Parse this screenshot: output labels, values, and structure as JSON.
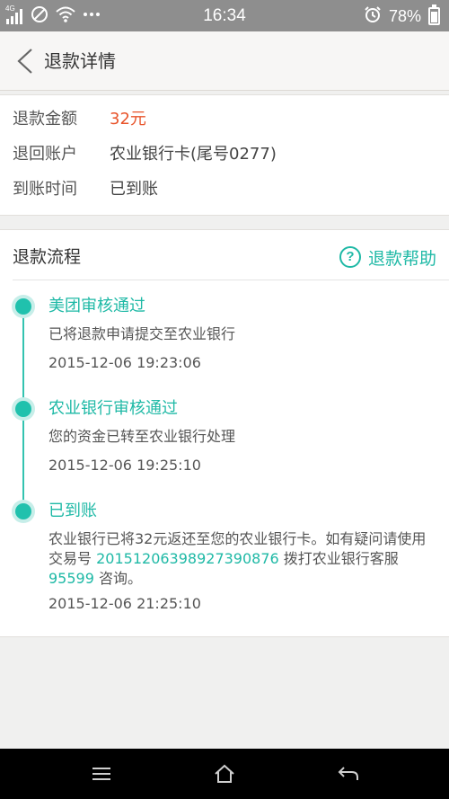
{
  "status_bar": {
    "network": "4G",
    "time": "16:34",
    "battery_percent": "78%",
    "battery_level": 0.78,
    "icons": [
      "signal-icon",
      "do-not-disturb-icon",
      "wifi-icon",
      "more-icon",
      "alarm-icon",
      "battery-icon"
    ]
  },
  "header": {
    "title": "退款详情",
    "back_icon": "chevron-left-icon"
  },
  "refund_info": {
    "amount_label": "退款金额",
    "amount_value": "32元",
    "account_label": "退回账户",
    "account_value": "农业银行卡(尾号0277)",
    "arrival_label": "到账时间",
    "arrival_value": "已到账"
  },
  "flow": {
    "title": "退款流程",
    "help_label": "退款帮助",
    "help_icon": "question-circle-icon",
    "steps": [
      {
        "title": "美团审核通过",
        "desc": "已将退款申请提交至农业银行",
        "time": "2015-12-06 19:23:06"
      },
      {
        "title": "农业银行审核通过",
        "desc": "您的资金已转至农业银行处理",
        "time": "2015-12-06 19:25:10"
      },
      {
        "title": "已到账",
        "desc_part1": "农业银行已将32元返还至您的农业银行卡。如有疑问请使用交易号",
        "transaction_no": "20151206398927390876",
        "desc_part2": "拨打农业银行客服",
        "service_phone": "95599",
        "desc_part3": "咨询。",
        "time": "2015-12-06 21:25:10"
      }
    ]
  },
  "colors": {
    "accent": "#1fb9a6",
    "amount": "#e8542b",
    "status_bar": "#8e8e8e",
    "page_bg": "#f0f0ef"
  },
  "soft_keys": [
    "menu-icon",
    "home-icon",
    "back-arrow-icon"
  ]
}
